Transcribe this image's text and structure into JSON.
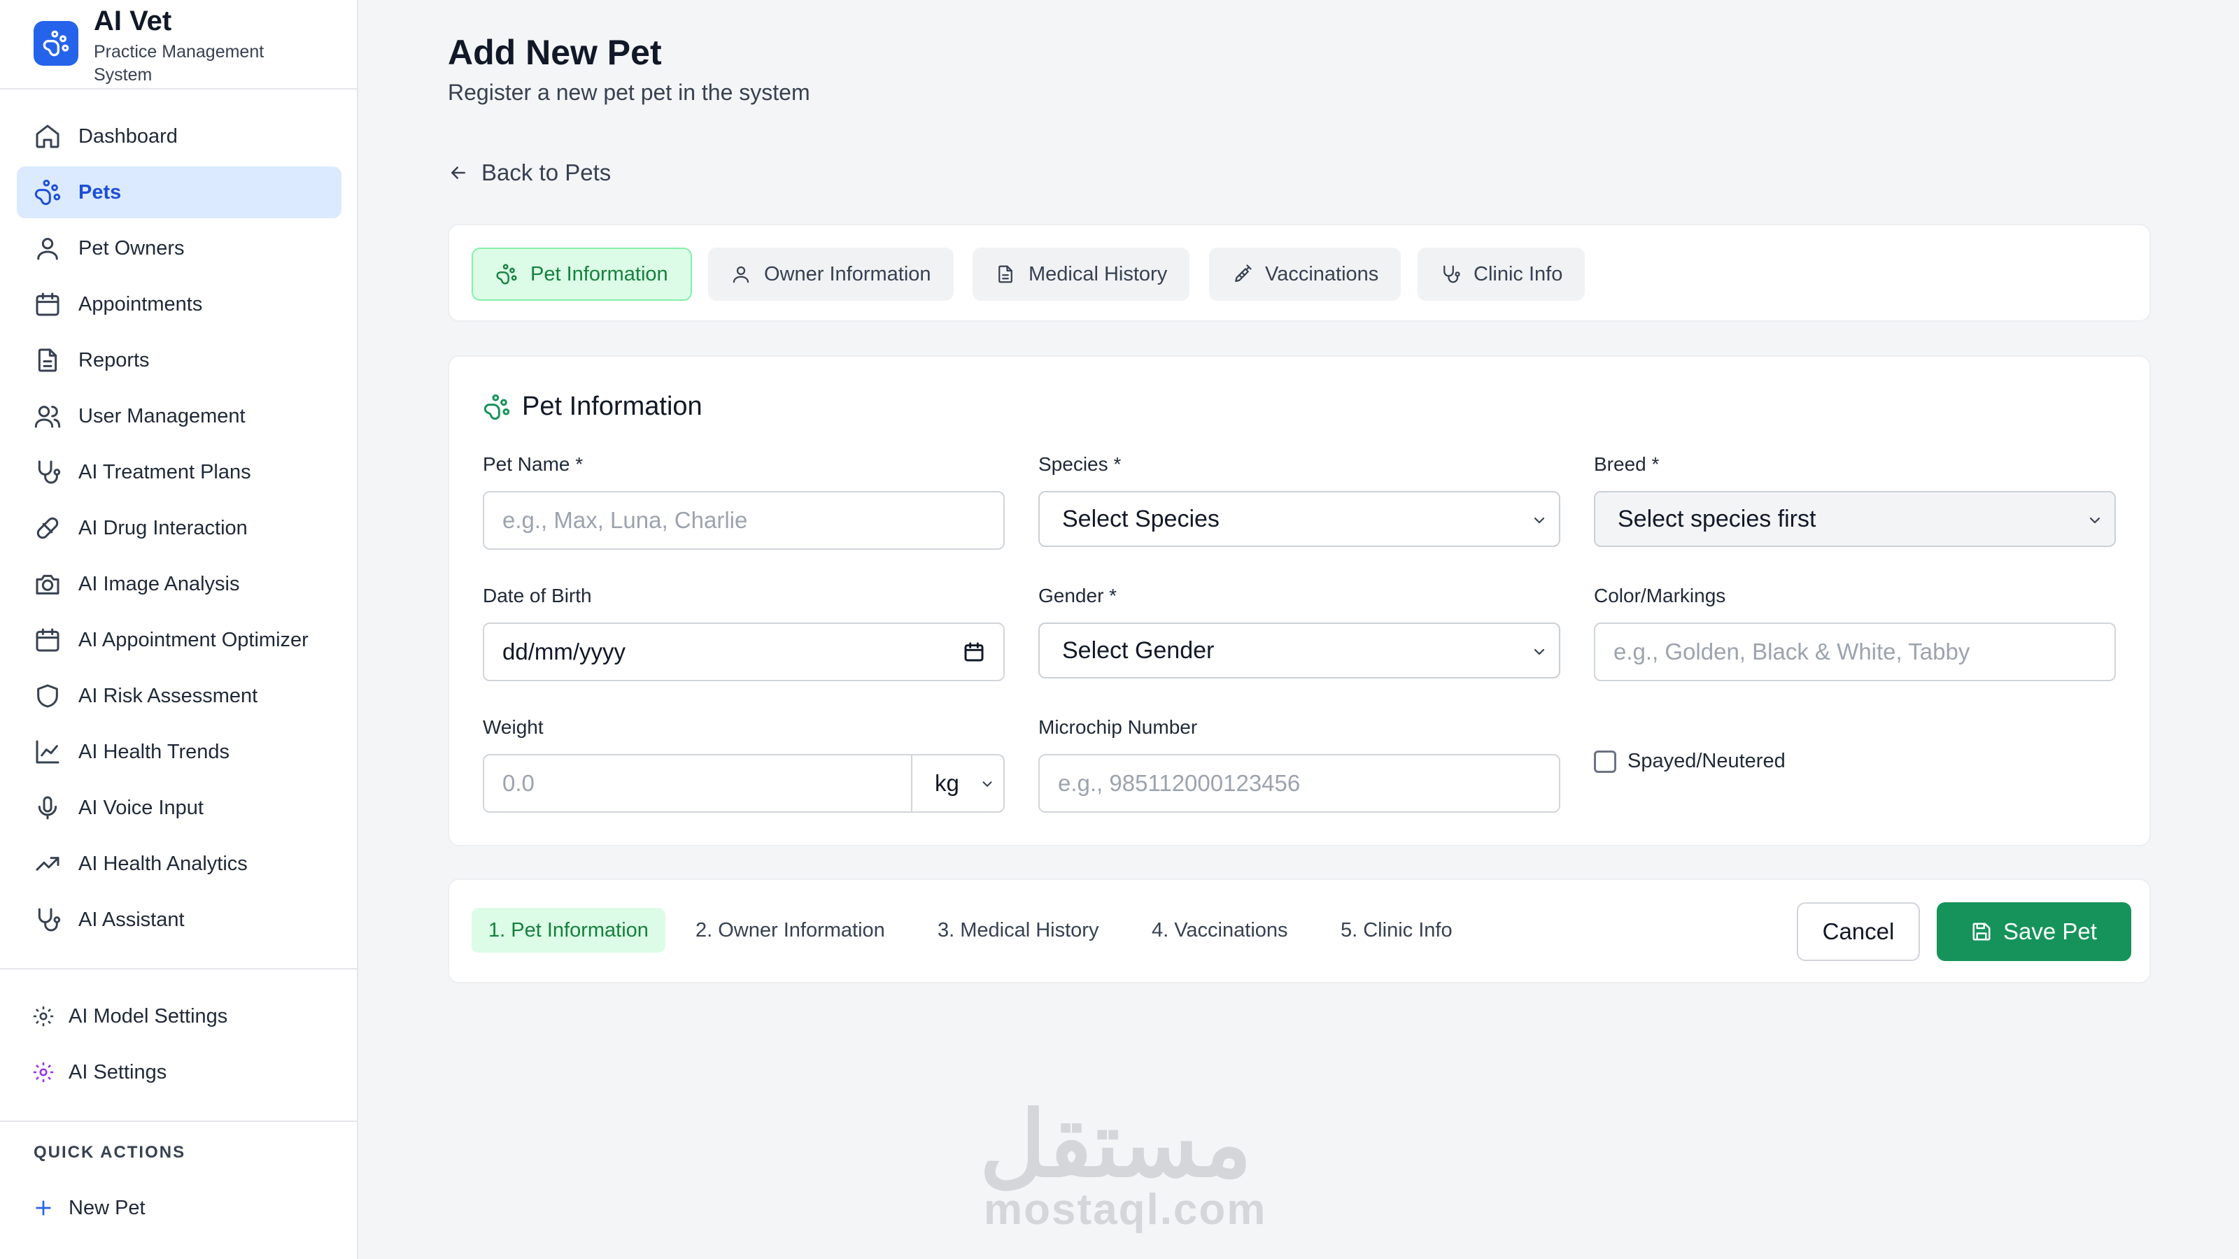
{
  "brand": {
    "name": "AI Vet",
    "subtitle": "Practice Management System"
  },
  "sidebar": {
    "items": [
      {
        "label": "Dashboard",
        "icon": "home-icon"
      },
      {
        "label": "Pets",
        "icon": "paw-icon",
        "active": true
      },
      {
        "label": "Pet Owners",
        "icon": "user-icon"
      },
      {
        "label": "Appointments",
        "icon": "calendar-icon"
      },
      {
        "label": "Reports",
        "icon": "document-icon"
      },
      {
        "label": "User Management",
        "icon": "users-icon"
      },
      {
        "label": "AI Treatment Plans",
        "icon": "stethoscope-icon"
      },
      {
        "label": "AI Drug Interaction",
        "icon": "pill-icon"
      },
      {
        "label": "AI Image Analysis",
        "icon": "camera-icon"
      },
      {
        "label": "AI Appointment Optimizer",
        "icon": "calendar-icon"
      },
      {
        "label": "AI Risk Assessment",
        "icon": "shield-icon"
      },
      {
        "label": "AI Health Trends",
        "icon": "line-chart-icon"
      },
      {
        "label": "AI Voice Input",
        "icon": "microphone-icon"
      },
      {
        "label": "AI Health Analytics",
        "icon": "trending-up-icon"
      },
      {
        "label": "AI Assistant",
        "icon": "stethoscope-icon"
      }
    ],
    "settings": [
      {
        "label": "AI Model Settings",
        "icon": "gear-icon"
      },
      {
        "label": "AI Settings",
        "icon": "gear-icon"
      }
    ],
    "quick_actions_title": "QUICK ACTIONS",
    "quick_actions": [
      {
        "label": "New Pet",
        "icon": "plus-icon"
      }
    ]
  },
  "header": {
    "title": "Add New Pet",
    "subtitle": "Register a new pet pet in the system",
    "back_label": "Back to Pets"
  },
  "tabs": [
    {
      "label": "Pet Information",
      "icon": "paw-icon",
      "active": true
    },
    {
      "label": "Owner Information",
      "icon": "user-icon"
    },
    {
      "label": "Medical History",
      "icon": "document-icon"
    },
    {
      "label": "Vaccinations",
      "icon": "syringe-icon"
    },
    {
      "label": "Clinic Info",
      "icon": "stethoscope-icon"
    }
  ],
  "form": {
    "section_title": "Pet Information",
    "pet_name": {
      "label": "Pet Name *",
      "placeholder": "e.g., Max, Luna, Charlie",
      "value": ""
    },
    "species": {
      "label": "Species *",
      "value": "Select Species"
    },
    "breed": {
      "label": "Breed *",
      "value": "Select species first"
    },
    "dob": {
      "label": "Date of Birth",
      "value": "dd/mm/yyyy"
    },
    "gender": {
      "label": "Gender *",
      "value": "Select Gender"
    },
    "color": {
      "label": "Color/Markings",
      "placeholder": "e.g., Golden, Black & White, Tabby",
      "value": ""
    },
    "weight": {
      "label": "Weight",
      "placeholder": "0.0",
      "unit": "kg"
    },
    "microchip": {
      "label": "Microchip Number",
      "placeholder": "e.g., 985112000123456"
    },
    "spayed": {
      "label": "Spayed/Neutered",
      "checked": false
    }
  },
  "footer": {
    "steps": [
      {
        "label": "1. Pet Information",
        "active": true
      },
      {
        "label": "2. Owner Information"
      },
      {
        "label": "3. Medical History"
      },
      {
        "label": "4. Vaccinations"
      },
      {
        "label": "5. Clinic Info"
      }
    ],
    "cancel_label": "Cancel",
    "save_label": "Save Pet"
  },
  "watermark": {
    "arabic": "مستقل",
    "latin": "mostaql.com"
  },
  "colors": {
    "primary": "#2563eb",
    "accent_green": "#15935a",
    "active_tab_bg": "#dcfce7",
    "active_nav_bg": "#dbeafe"
  }
}
